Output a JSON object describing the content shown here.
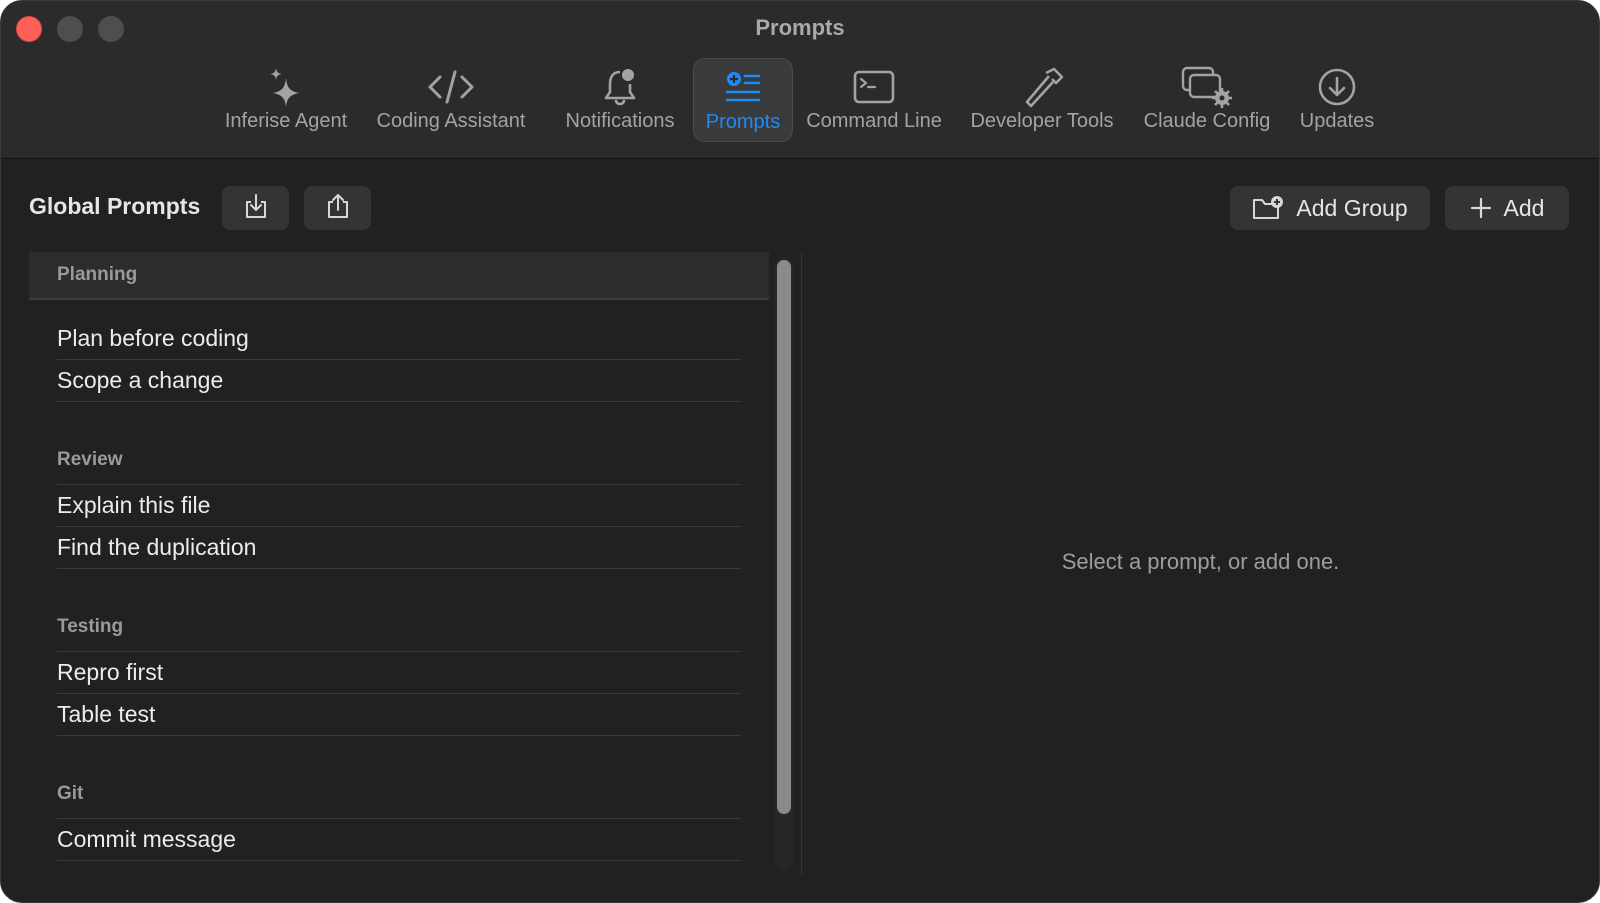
{
  "window": {
    "title": "Prompts"
  },
  "toolbar": {
    "tabs": [
      {
        "label": "Inferise Agent",
        "icon": "sparkle-icon"
      },
      {
        "label": "Coding Assistant",
        "icon": "code-brackets-icon"
      },
      {
        "label": "Notifications",
        "icon": "bell-badge-icon"
      },
      {
        "label": "Prompts",
        "icon": "list-add-icon",
        "active": true
      },
      {
        "label": "Command Line",
        "icon": "terminal-icon"
      },
      {
        "label": "Developer Tools",
        "icon": "hammer-icon"
      },
      {
        "label": "Claude Config",
        "icon": "windows-gear-icon"
      },
      {
        "label": "Updates",
        "icon": "download-circle-icon"
      }
    ]
  },
  "header": {
    "title": "Global Prompts",
    "import_icon": "import-tray-icon",
    "export_icon": "share-icon",
    "add_group_label": "Add Group",
    "add_label": "Add"
  },
  "groups": [
    {
      "name": "Planning",
      "items": [
        "Plan before coding",
        "Scope a change"
      ]
    },
    {
      "name": "Review",
      "items": [
        "Explain this file",
        "Find the duplication"
      ]
    },
    {
      "name": "Testing",
      "items": [
        "Repro first",
        "Table test"
      ]
    },
    {
      "name": "Git",
      "items": [
        "Commit message"
      ]
    }
  ],
  "detail": {
    "empty_message": "Select a prompt, or add one."
  },
  "colors": {
    "accent": "#1d8bf6",
    "close": "#fe5f57",
    "background": "#202120"
  }
}
